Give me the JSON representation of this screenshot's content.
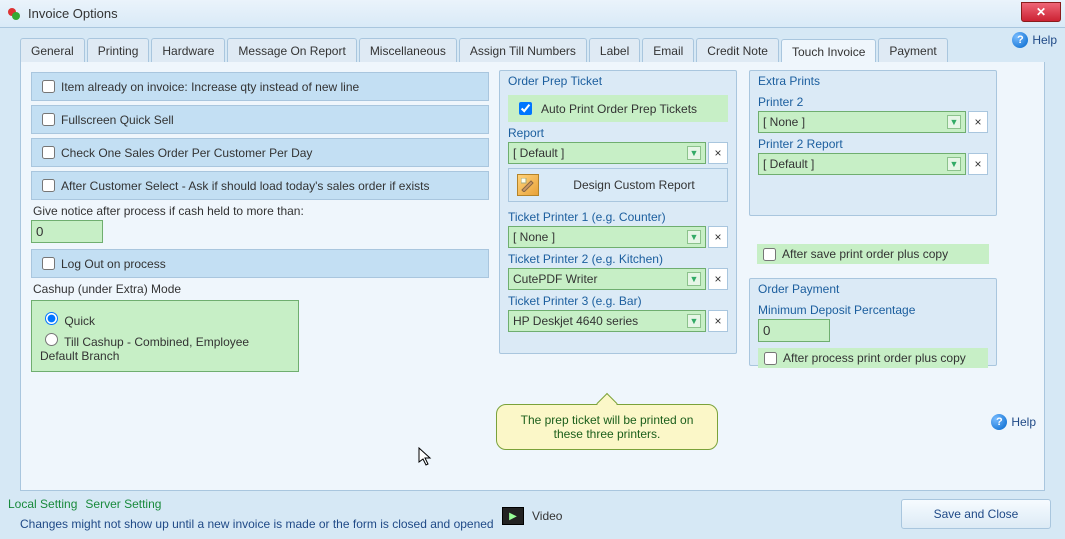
{
  "window": {
    "title": "Invoice Options"
  },
  "help": {
    "label": "Help"
  },
  "tabs": [
    {
      "label": "General"
    },
    {
      "label": "Printing"
    },
    {
      "label": "Hardware"
    },
    {
      "label": "Message On Report"
    },
    {
      "label": "Miscellaneous"
    },
    {
      "label": "Assign Till Numbers"
    },
    {
      "label": "Label"
    },
    {
      "label": "Email"
    },
    {
      "label": "Credit Note"
    },
    {
      "label": "Touch Invoice",
      "active": true
    },
    {
      "label": "Payment"
    }
  ],
  "left": {
    "checks": [
      {
        "label": "Item already on invoice: Increase qty instead of new line",
        "checked": false
      },
      {
        "label": "Fullscreen Quick Sell",
        "checked": false
      },
      {
        "label": "Check One Sales Order Per Customer Per Day",
        "checked": false
      },
      {
        "label": "After Customer Select - Ask if should load today's sales order if exists",
        "checked": false
      }
    ],
    "notice_label": "Give notice after process if cash held to more than:",
    "notice_value": "0",
    "logout": {
      "label": "Log Out on process",
      "checked": false
    },
    "cashup_label": "Cashup (under Extra) Mode",
    "cashup_options": [
      {
        "label": "Quick",
        "checked": true
      },
      {
        "label": "Till Cashup - Combined, Employee Default Branch",
        "checked": false
      }
    ]
  },
  "prep": {
    "legend": "Order Prep Ticket",
    "auto": {
      "label": "Auto Print Order Prep Tickets",
      "checked": true
    },
    "report_label": "Report",
    "report_value": "[ Default ]",
    "design_btn": "Design Custom Report",
    "p1_label": "Ticket Printer 1 (e.g. Counter)",
    "p1_value": "[ None ]",
    "p2_label": "Ticket Printer 2 (e.g. Kitchen)",
    "p2_value": "CutePDF Writer",
    "p3_label": "Ticket Printer 3 (e.g. Bar)",
    "p3_value": "HP Deskjet 4640 series"
  },
  "extra": {
    "legend": "Extra Prints",
    "p2_label": "Printer 2",
    "p2_value": "[ None ]",
    "p2r_label": "Printer 2 Report",
    "p2r_value": "[ Default ]",
    "after_save": {
      "label": "After save print order plus copy",
      "checked": false
    }
  },
  "payment": {
    "legend": "Order Payment",
    "min_label": "Minimum Deposit Percentage",
    "min_value": "0",
    "after_process": {
      "label": "After process print order plus copy",
      "checked": false
    }
  },
  "tooltip": "The prep ticket will be printed on these three printers.",
  "footer": {
    "local": "Local Setting",
    "server": "Server Setting",
    "note": "Changes might not show up until a new invoice is made or the form is closed and opened",
    "video": "Video",
    "save": "Save and Close"
  },
  "chart_data": null
}
